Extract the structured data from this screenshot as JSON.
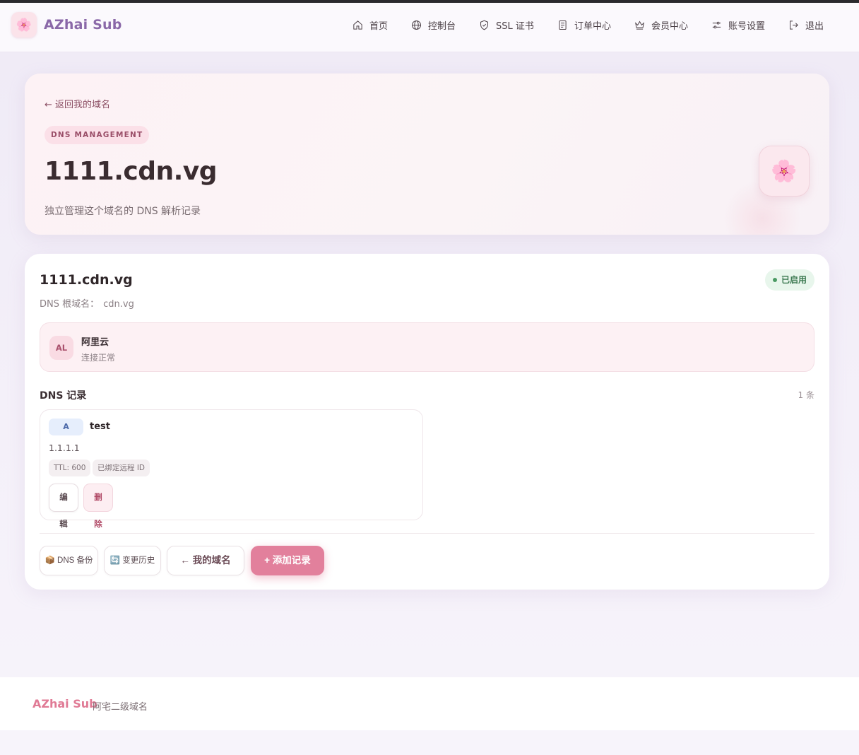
{
  "brand": {
    "logo_glyph": "🌸",
    "name": "AZhai Sub"
  },
  "nav": [
    {
      "label": "首页",
      "icon": "home-icon"
    },
    {
      "label": "控制台",
      "icon": "globe-icon"
    },
    {
      "label": "SSL 证书",
      "icon": "shield-icon"
    },
    {
      "label": "订单中心",
      "icon": "document-icon"
    },
    {
      "label": "会员中心",
      "icon": "crown-icon"
    },
    {
      "label": "账号设置",
      "icon": "settings-sliders-icon"
    },
    {
      "label": "退出",
      "icon": "logout-icon"
    }
  ],
  "hero": {
    "back_link": "← 返回我的域名",
    "tag": "DNS MANAGEMENT",
    "title": "1111.cdn.vg",
    "subtitle": "独立管理这个域名的 DNS 解析记录",
    "badge_glyph": "🌸"
  },
  "domain_card": {
    "title": "1111.cdn.vg",
    "root_label": "DNS 根域名：",
    "root_value": "cdn.vg",
    "status": "已启用",
    "provider": {
      "avatar": "AL",
      "name": "阿里云",
      "status": "连接正常"
    },
    "records_title": "DNS 记录",
    "records_count": "1 条",
    "records": [
      {
        "type": "A",
        "name": "test",
        "value": "1.1.1.1",
        "ttl": "TTL: 600",
        "bound": "已绑定远程 ID",
        "edit": "编辑",
        "delete": "删除"
      }
    ],
    "actions": {
      "backup": "📦 DNS 备份",
      "history": "🔄 变更历史",
      "my_domains": "← 我的域名",
      "add_record": "+ 添加记录"
    }
  },
  "footer": {
    "brand": "AZhai Sub",
    "tagline": "阿宅二级域名"
  },
  "colors": {
    "accent": "#e2809c",
    "brand_purple": "#8a68a8",
    "status_green": "#3d7a52"
  }
}
